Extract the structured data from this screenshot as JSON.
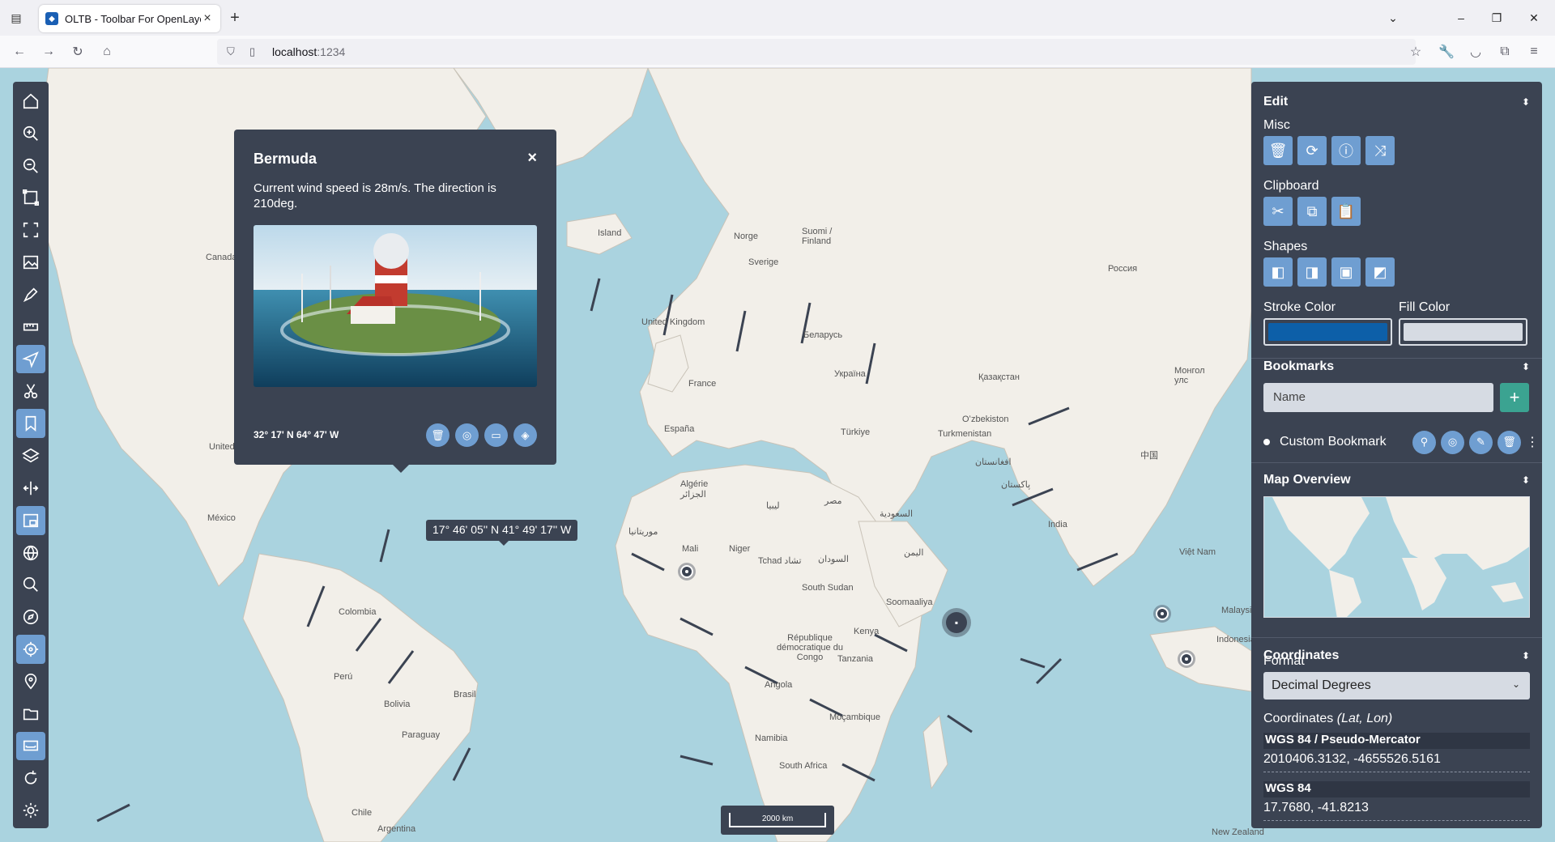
{
  "browser": {
    "tab_title": "OLTB - Toolbar For OpenLayers",
    "url_host": "localhost",
    "url_port": ":1234"
  },
  "map": {
    "labels": [
      {
        "text": "Island"
      },
      {
        "text": "Norge"
      },
      {
        "text": "Sverige"
      },
      {
        "text": "Suomi / Finland"
      },
      {
        "text": "Россия"
      },
      {
        "text": "United Kingdom"
      },
      {
        "text": "Беларусь"
      },
      {
        "text": "Україна"
      },
      {
        "text": "Қазақстан"
      },
      {
        "text": "Монгол улс"
      },
      {
        "text": "France"
      },
      {
        "text": "España"
      },
      {
        "text": "Türkiye"
      },
      {
        "text": "Oʻzbekiston"
      },
      {
        "text": "Turkmenistan"
      },
      {
        "text": "افغانستان"
      },
      {
        "text": "پاکستان"
      },
      {
        "text": "中国"
      },
      {
        "text": "India"
      },
      {
        "text": "Canada"
      },
      {
        "text": "United States"
      },
      {
        "text": "México"
      },
      {
        "text": "Colombia"
      },
      {
        "text": "Perú"
      },
      {
        "text": "Brasil"
      },
      {
        "text": "Bolivia"
      },
      {
        "text": "Paraguay"
      },
      {
        "text": "Chile"
      },
      {
        "text": "Argentina"
      },
      {
        "text": "Algérie الجزائر"
      },
      {
        "text": "ليبيا"
      },
      {
        "text": "مصر"
      },
      {
        "text": "Mali"
      },
      {
        "text": "Niger"
      },
      {
        "text": "Tchad تشاد"
      },
      {
        "text": "السودان"
      },
      {
        "text": "South Sudan"
      },
      {
        "text": "موريتانيا"
      },
      {
        "text": "السعودية"
      },
      {
        "text": "اليمن"
      },
      {
        "text": "Soomaaliya"
      },
      {
        "text": "Kenya"
      },
      {
        "text": "Tanzania"
      },
      {
        "text": "République démocratique du Congo"
      },
      {
        "text": "Angola"
      },
      {
        "text": "Namibia"
      },
      {
        "text": "South Africa"
      },
      {
        "text": "Moçambique"
      },
      {
        "text": "Việt Nam"
      },
      {
        "text": "Indonesia"
      },
      {
        "text": "Malaysia"
      },
      {
        "text": "New Zealand"
      }
    ]
  },
  "toolbar": {
    "tools": [
      {
        "icon": "home-icon"
      },
      {
        "icon": "zoom-in-icon"
      },
      {
        "icon": "zoom-out-icon"
      },
      {
        "icon": "zoombox-icon"
      },
      {
        "icon": "fullscreen-icon"
      },
      {
        "icon": "export-png-icon"
      },
      {
        "icon": "draw-icon"
      },
      {
        "icon": "measure-icon"
      },
      {
        "icon": "edit-icon",
        "active": true
      },
      {
        "icon": "scissors-icon"
      },
      {
        "icon": "bookmark-icon",
        "active": true
      },
      {
        "icon": "layers-icon"
      },
      {
        "icon": "split-view-icon"
      },
      {
        "icon": "overview-icon",
        "active": true
      },
      {
        "icon": "graticule-icon"
      },
      {
        "icon": "magnify-icon"
      },
      {
        "icon": "direction-icon"
      },
      {
        "icon": "my-location-icon",
        "active": true
      },
      {
        "icon": "marker-icon"
      },
      {
        "icon": "import-icon"
      },
      {
        "icon": "scale-line-icon",
        "active": true
      },
      {
        "icon": "refresh-icon"
      },
      {
        "icon": "theme-icon"
      }
    ]
  },
  "popup": {
    "title": "Bermuda",
    "close": "×",
    "text": "Current wind speed is 28m/s. The direction is 210deg.",
    "coords": "32° 17' N 64° 47' W"
  },
  "cursor_coordinates": "17° 46' 05'' N 41° 49' 17'' W",
  "scale_line": "2000 km",
  "panel": {
    "edit": {
      "title": "Edit",
      "misc_label": "Misc",
      "clipboard_label": "Clipboard",
      "shapes_label": "Shapes",
      "stroke_label": "Stroke Color",
      "fill_label": "Fill Color",
      "stroke_color": "#0d5fa8",
      "fill_color": "#d6dbe3"
    },
    "bookmarks": {
      "title": "Bookmarks",
      "placeholder": "Name",
      "add": "+",
      "items": [
        {
          "label": "Custom Bookmark"
        }
      ]
    },
    "overview": {
      "title": "Map Overview"
    },
    "coordinates": {
      "title": "Coordinates",
      "format_label": "Format",
      "format_value": "Decimal Degrees",
      "subtitle": "Coordinates",
      "subtitle_hint": "(Lat, Lon)",
      "blocks": [
        {
          "name": "WGS 84 / Pseudo-Mercator",
          "value": "2010406.3132, -4655526.5161"
        },
        {
          "name": "WGS 84",
          "value": "17.7680, -41.8213"
        }
      ]
    }
  },
  "colors": {
    "accent": "#6f9ed1",
    "panel": "#3b4352",
    "ocean": "#aad3df",
    "land": "#f2efe9",
    "success": "#3ba391"
  }
}
